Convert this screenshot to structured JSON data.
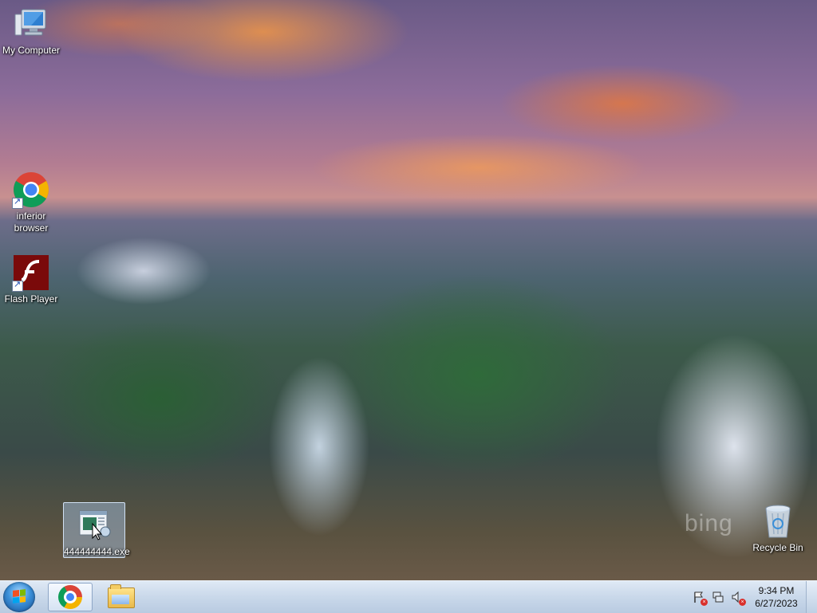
{
  "desktop": {
    "icons": [
      {
        "label": "My Computer",
        "icon": "computer-icon"
      },
      {
        "label": "inferior browser",
        "icon": "chrome-icon",
        "shortcut": true
      },
      {
        "label": "Flash Player",
        "icon": "flash-icon",
        "shortcut": true
      },
      {
        "label": "444444444.exe",
        "icon": "executable-icon",
        "selected": true
      },
      {
        "label": "Recycle Bin",
        "icon": "recycle-bin-icon"
      }
    ],
    "watermark": "bing"
  },
  "taskbar": {
    "start": {
      "icon": "windows-start-icon"
    },
    "pinned": [
      {
        "name": "Google Chrome",
        "icon": "chrome-icon",
        "active": true
      },
      {
        "name": "Windows Explorer",
        "icon": "folder-icon",
        "active": false
      }
    ],
    "tray": {
      "icons": [
        "action-center-icon",
        "network-icon",
        "volume-muted-icon"
      ]
    },
    "clock": {
      "time": "9:34 PM",
      "date": "6/27/2023"
    }
  },
  "colors": {
    "taskbar": "#c9d8ea",
    "selection": "#aac8eb",
    "flash_red": "#7a0a0a"
  }
}
